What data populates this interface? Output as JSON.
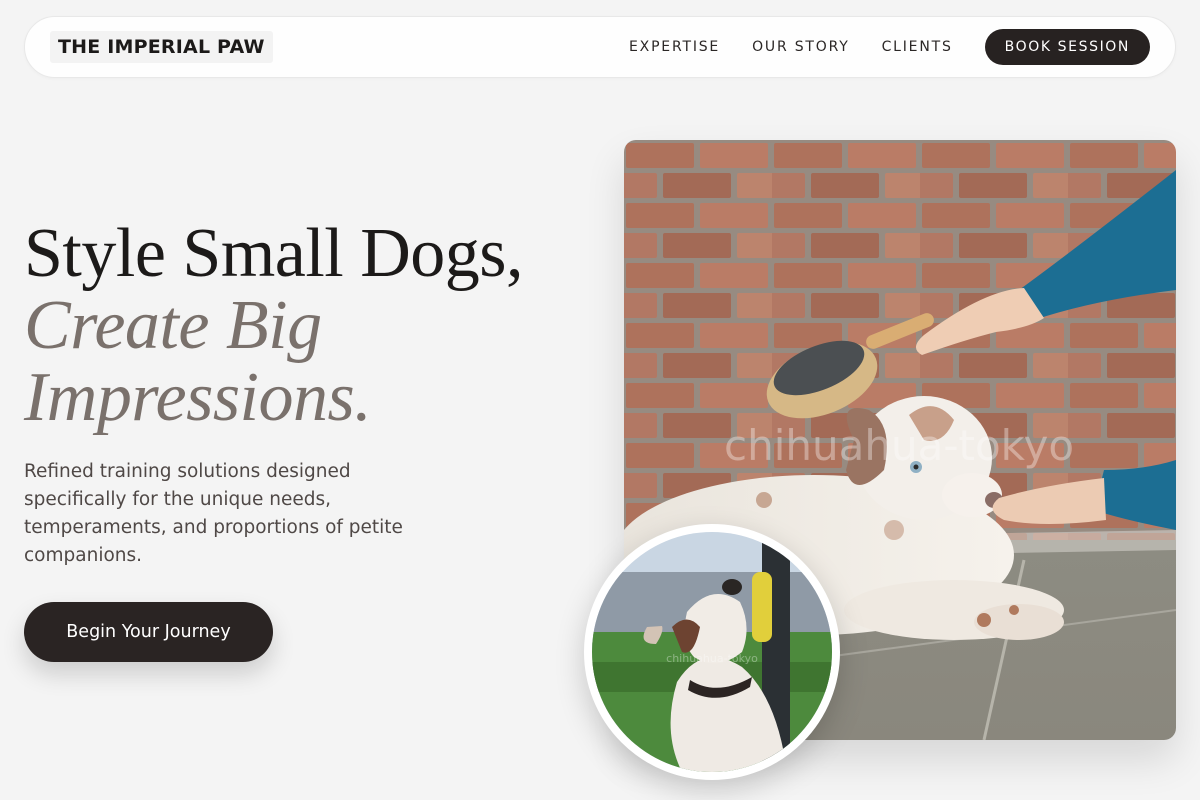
{
  "nav": {
    "brand": "THE IMPERIAL PAW",
    "links": [
      "EXPERTISE",
      "OUR STORY",
      "CLIENTS"
    ],
    "cta": "BOOK SESSION"
  },
  "hero": {
    "headline_line1": "Style Small Dogs,",
    "headline_line2": "Create Big Impressions.",
    "subtext": "Refined training solutions designed specifically for the unique needs, temperaments, and proportions of petite companions.",
    "cta": "Begin Your Journey",
    "main_image_watermark": "chihuahua-tokyo",
    "inset_image_watermark": "chihuahua-tokyo"
  }
}
